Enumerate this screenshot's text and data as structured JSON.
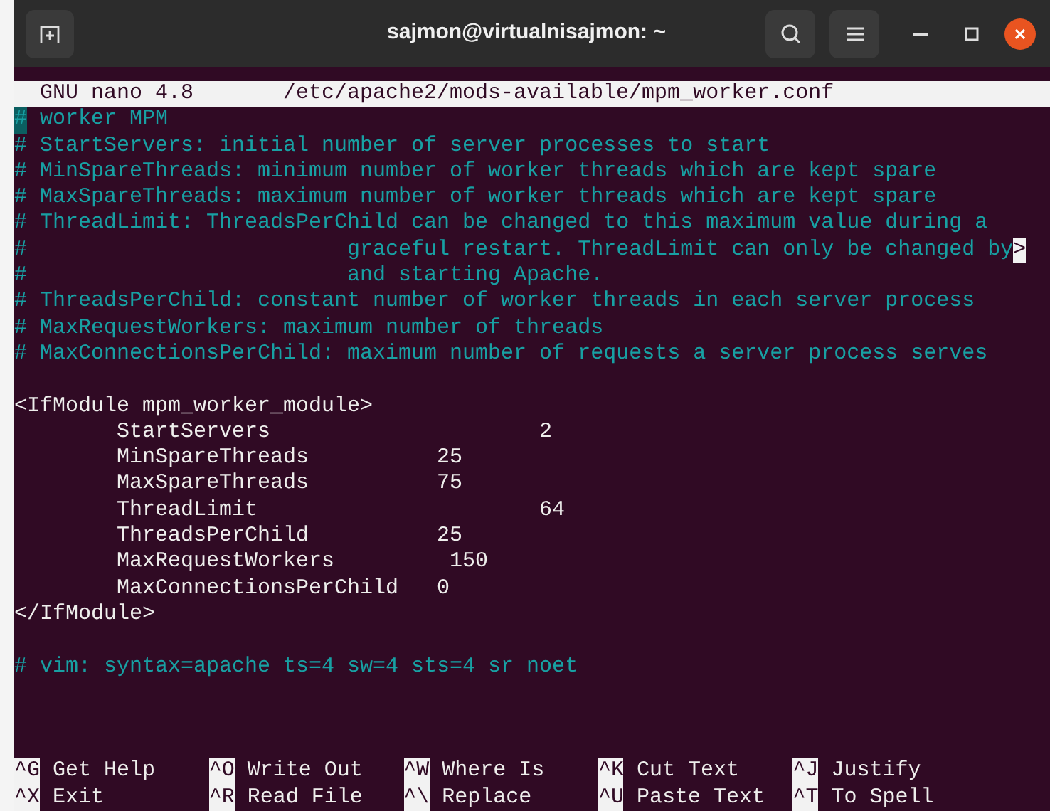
{
  "window": {
    "title": "sajmon@virtualnisajmon: ~"
  },
  "nano_header": {
    "version": "GNU nano 4.8",
    "filename": "/etc/apache2/mods-available/mpm_worker.conf"
  },
  "lines": [
    {
      "kind": "comment",
      "text": "# worker MPM",
      "cursor": true
    },
    {
      "kind": "comment",
      "text": "# StartServers: initial number of server processes to start",
      "cursor": false
    },
    {
      "kind": "comment",
      "text": "# MinSpareThreads: minimum number of worker threads which are kept spare",
      "cursor": false
    },
    {
      "kind": "comment",
      "text": "# MaxSpareThreads: maximum number of worker threads which are kept spare",
      "cursor": false
    },
    {
      "kind": "comment",
      "text": "# ThreadLimit: ThreadsPerChild can be changed to this maximum value during a",
      "cursor": false
    },
    {
      "kind": "comment",
      "text": "#                         graceful restart. ThreadLimit can only be changed by",
      "cursor": false,
      "overflow": ">"
    },
    {
      "kind": "comment",
      "text": "#                         and starting Apache.",
      "cursor": false
    },
    {
      "kind": "comment",
      "text": "# ThreadsPerChild: constant number of worker threads in each server process",
      "cursor": false
    },
    {
      "kind": "comment",
      "text": "# MaxRequestWorkers: maximum number of threads",
      "cursor": false
    },
    {
      "kind": "comment",
      "text": "# MaxConnectionsPerChild: maximum number of requests a server process serves",
      "cursor": false
    },
    {
      "kind": "blank",
      "cursor": false
    },
    {
      "kind": "code",
      "text": "<IfModule mpm_worker_module>",
      "cursor": false
    },
    {
      "kind": "code",
      "text": "        StartServers                     2",
      "cursor": false
    },
    {
      "kind": "code",
      "text": "        MinSpareThreads          25",
      "cursor": false
    },
    {
      "kind": "code",
      "text": "        MaxSpareThreads          75",
      "cursor": false
    },
    {
      "kind": "code",
      "text": "        ThreadLimit                      64",
      "cursor": false
    },
    {
      "kind": "code",
      "text": "        ThreadsPerChild          25",
      "cursor": false
    },
    {
      "kind": "code",
      "text": "        MaxRequestWorkers         150",
      "cursor": false
    },
    {
      "kind": "code",
      "text": "        MaxConnectionsPerChild   0",
      "cursor": false
    },
    {
      "kind": "code",
      "text": "</IfModule>",
      "cursor": false
    },
    {
      "kind": "blank",
      "cursor": false
    },
    {
      "kind": "comment",
      "text": "# vim: syntax=apache ts=4 sw=4 sts=4 sr noet",
      "cursor": false
    }
  ],
  "shortcut_rows": [
    [
      {
        "key": "^G",
        "label": "Get Help"
      },
      {
        "key": "^O",
        "label": "Write Out"
      },
      {
        "key": "^W",
        "label": "Where Is"
      },
      {
        "key": "^K",
        "label": "Cut Text"
      },
      {
        "key": "^J",
        "label": "Justify"
      }
    ],
    [
      {
        "key": "^X",
        "label": "Exit"
      },
      {
        "key": "^R",
        "label": "Read File"
      },
      {
        "key": "^\\",
        "label": "Replace"
      },
      {
        "key": "^U",
        "label": "Paste Text"
      },
      {
        "key": "^T",
        "label": "To Spell"
      }
    ]
  ]
}
